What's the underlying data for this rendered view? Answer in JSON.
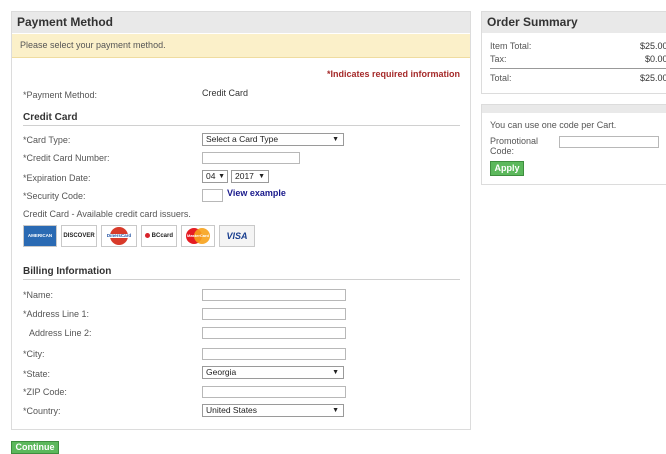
{
  "payment": {
    "title": "Payment Method",
    "notice": "Please select your payment method.",
    "required_note": "*Indicates required information",
    "method_label": "*Payment Method:",
    "method_value": "Credit Card"
  },
  "credit_card": {
    "section_title": "Credit Card",
    "card_type_label": "*Card Type:",
    "card_type_value": "Select a Card Type",
    "card_number_label": "*Credit Card Number:",
    "expiration_label": "*Expiration Date:",
    "exp_month": "04",
    "exp_year": "2017",
    "security_label": "*Security Code:",
    "view_example": "View example",
    "issuers_text": "Credit Card - Available credit card issuers.",
    "issuers": [
      "AMERICAN EXPRESS",
      "DISCOVER",
      "DinersCard",
      "BCcard",
      "MasterCard",
      "VISA"
    ]
  },
  "billing": {
    "section_title": "Billing Information",
    "name_label": "*Name:",
    "address1_label": "*Address Line 1:",
    "address2_label": "Address Line 2:",
    "city_label": "*City:",
    "state_label": "*State:",
    "state_value": "Georgia",
    "zip_label": "*ZIP Code:",
    "country_label": "*Country:",
    "country_value": "United States"
  },
  "continue_label": "Continue",
  "order_summary": {
    "title": "Order Summary",
    "item_total_label": "Item Total:",
    "item_total_value": "$25.00",
    "tax_label": "Tax:",
    "tax_value": "$0.00",
    "total_label": "Total:",
    "total_value": "$25.00"
  },
  "promo": {
    "note": "You can use one code per Cart.",
    "code_label": "Promotional Code:",
    "apply_label": "Apply"
  },
  "colors": {
    "accent_green": "#5cb85c",
    "required_red": "#a52a2a",
    "link_blue": "#1a1a8c",
    "notice_bg": "#fbf0c9"
  }
}
